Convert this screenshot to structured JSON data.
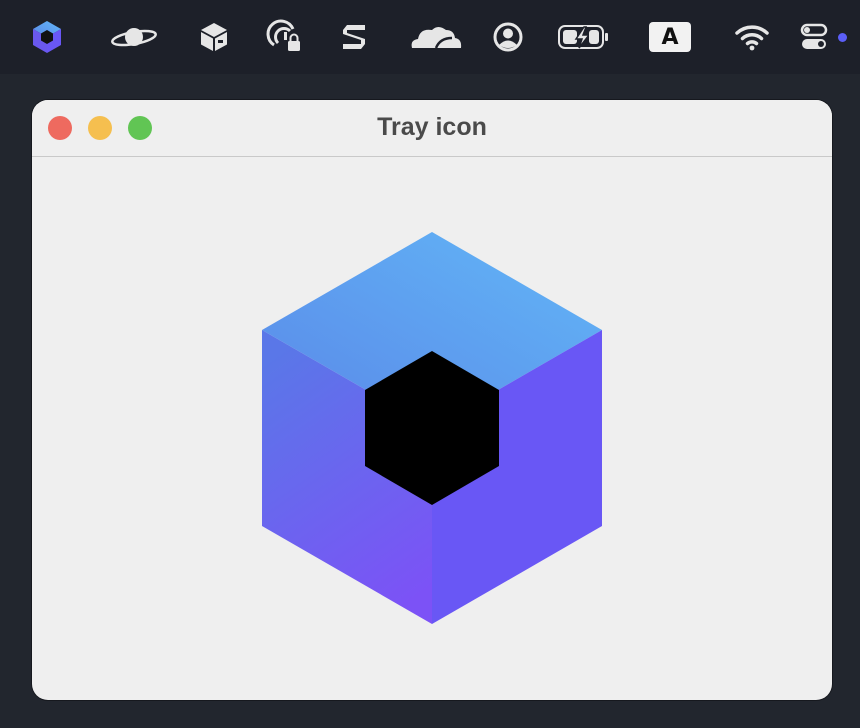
{
  "menubar": {
    "tray_icons": [
      "app-hexagon-icon",
      "saturn-icon",
      "package-box-icon",
      "fingerprint-lock-icon",
      "s-logo-icon",
      "cloud-icon",
      "user-circle-icon",
      "battery-charging-icon",
      "keyboard-input-icon",
      "wifi-icon",
      "control-center-icon"
    ],
    "input_source_label": "A",
    "notification_dot_color": "#5b5ef7"
  },
  "window": {
    "title": "Tray icon",
    "traffic_lights": {
      "close_color": "#ee6a5f",
      "minimize_color": "#f5bf4f",
      "maximize_color": "#61c554"
    }
  },
  "content": {
    "icon": "hexagon-cube-logo",
    "colors": {
      "top_light": "#62b7f7",
      "top_dark": "#5a88e8",
      "left_top": "#5a77e8",
      "left_bottom": "#7c52f6",
      "right": "#6957f5",
      "center": "#000000"
    }
  }
}
